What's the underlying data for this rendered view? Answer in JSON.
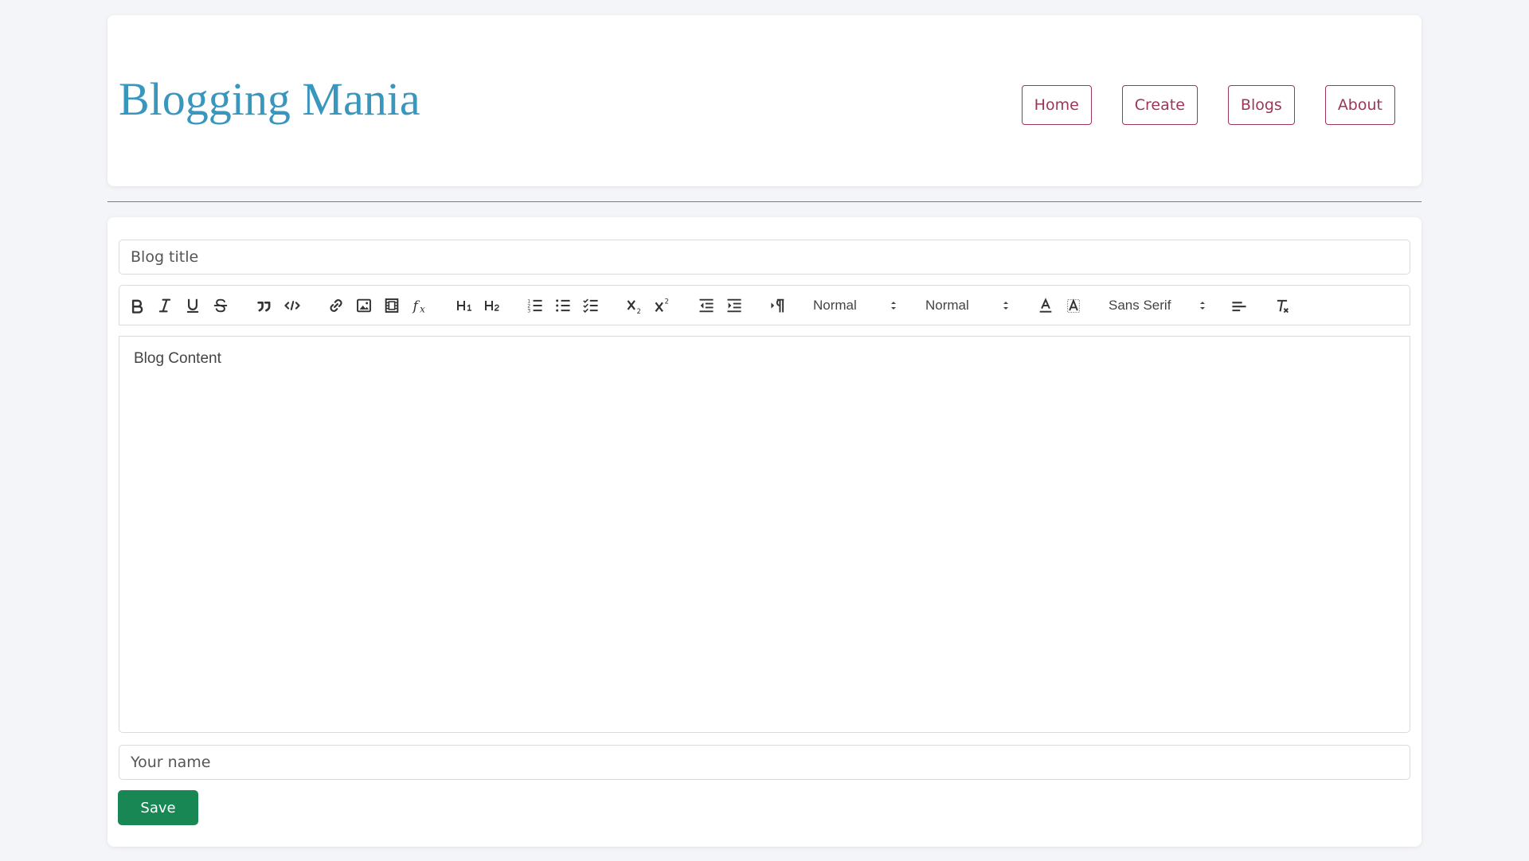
{
  "header": {
    "brand": "Blogging Mania",
    "nav": [
      {
        "label": "Home"
      },
      {
        "label": "Create"
      },
      {
        "label": "Blogs"
      },
      {
        "label": "About"
      }
    ]
  },
  "form": {
    "title_placeholder": "Blog title",
    "content_placeholder": "Blog Content",
    "name_placeholder": "Your name",
    "save_label": "Save"
  },
  "toolbar": {
    "header_size": "Normal",
    "font_size": "Normal",
    "font_family": "Sans Serif",
    "buttons": [
      "bold",
      "italic",
      "underline",
      "strike",
      "blockquote",
      "code-block",
      "link",
      "image",
      "video",
      "formula",
      "h1",
      "h2",
      "ordered-list",
      "bullet-list",
      "check-list",
      "subscript",
      "superscript",
      "indent-decrease",
      "indent-increase",
      "text-direction",
      "font-color",
      "background-color",
      "align",
      "clean"
    ]
  },
  "colors": {
    "brand": "#3996bd",
    "nav_accent": "#9b3559",
    "divider": "#e54b5e",
    "save": "#198754",
    "background": "#f4f5f8"
  }
}
